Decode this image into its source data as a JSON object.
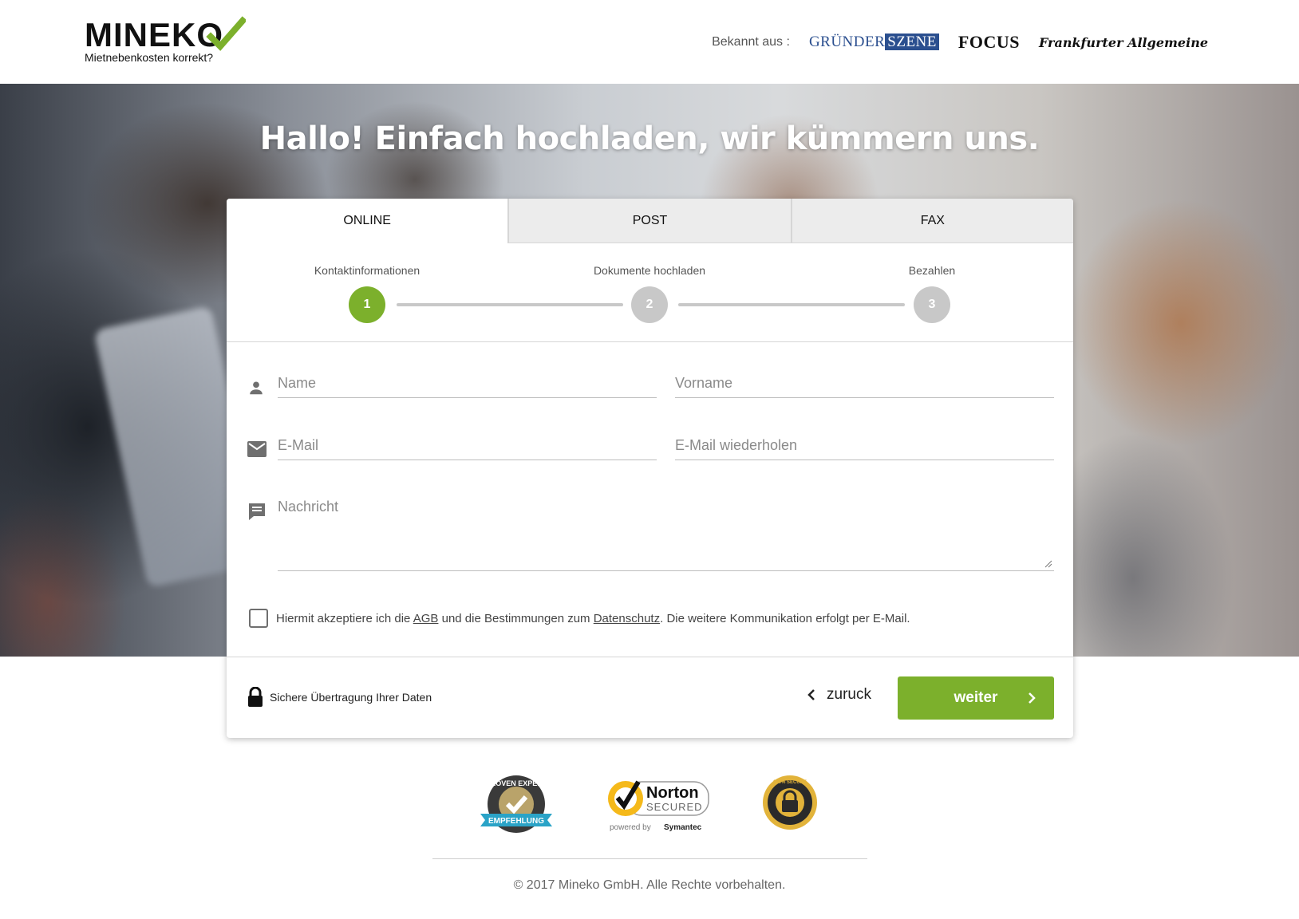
{
  "header": {
    "logo_word": "MINEKO",
    "logo_tagline": "Mietnebenkosten korrekt?",
    "press_label": "Bekannt aus :",
    "press": {
      "gruenderszene_a": "GRÜNDER",
      "gruenderszene_b": "SZENE",
      "focus": "FOCUS",
      "faz": "Frankfurter Allgemeine"
    }
  },
  "hero": {
    "title": "Hallo! Einfach hochladen, wir kümmern uns."
  },
  "tabs": [
    "ONLINE",
    "POST",
    "FAX"
  ],
  "steps": [
    {
      "label": "Kontaktinformationen",
      "number": "1",
      "active": true
    },
    {
      "label": "Dokumente hochladen",
      "number": "2",
      "active": false
    },
    {
      "label": "Bezahlen",
      "number": "3",
      "active": false
    }
  ],
  "form": {
    "name_placeholder": "Name",
    "vorname_placeholder": "Vorname",
    "email_placeholder": "E-Mail",
    "email_repeat_placeholder": "E-Mail wiederholen",
    "message_placeholder": "Nachricht"
  },
  "consent": {
    "prefix": "Hiermit akzeptiere ich die",
    "agb": "AGB",
    "middle": "und die Bestimmungen zum",
    "datenschutz": "Datenschutz",
    "suffix": ". Die weitere Kommunikation erfolgt per E-Mail."
  },
  "footer_bar": {
    "secure_text": "Sichere Übertragung Ihrer Daten",
    "back_label": "zuruck",
    "next_label": "weiter"
  },
  "badges": {
    "proven_expert_top": "PROVEN EXPERT",
    "proven_expert_ribbon": "EMPFEHLUNG",
    "norton_name": "Norton",
    "norton_secured": "SECURED",
    "norton_powered": "powered by",
    "norton_symantec": "Symantec",
    "secure_seal": "100% SECURE"
  },
  "copyright": "© 2017 Mineko GmbH. Alle Rechte vorbehalten.",
  "colors": {
    "accent": "#7cb02c",
    "inactive_step": "#c8c8c8",
    "press_blue": "#2b4f8f"
  }
}
